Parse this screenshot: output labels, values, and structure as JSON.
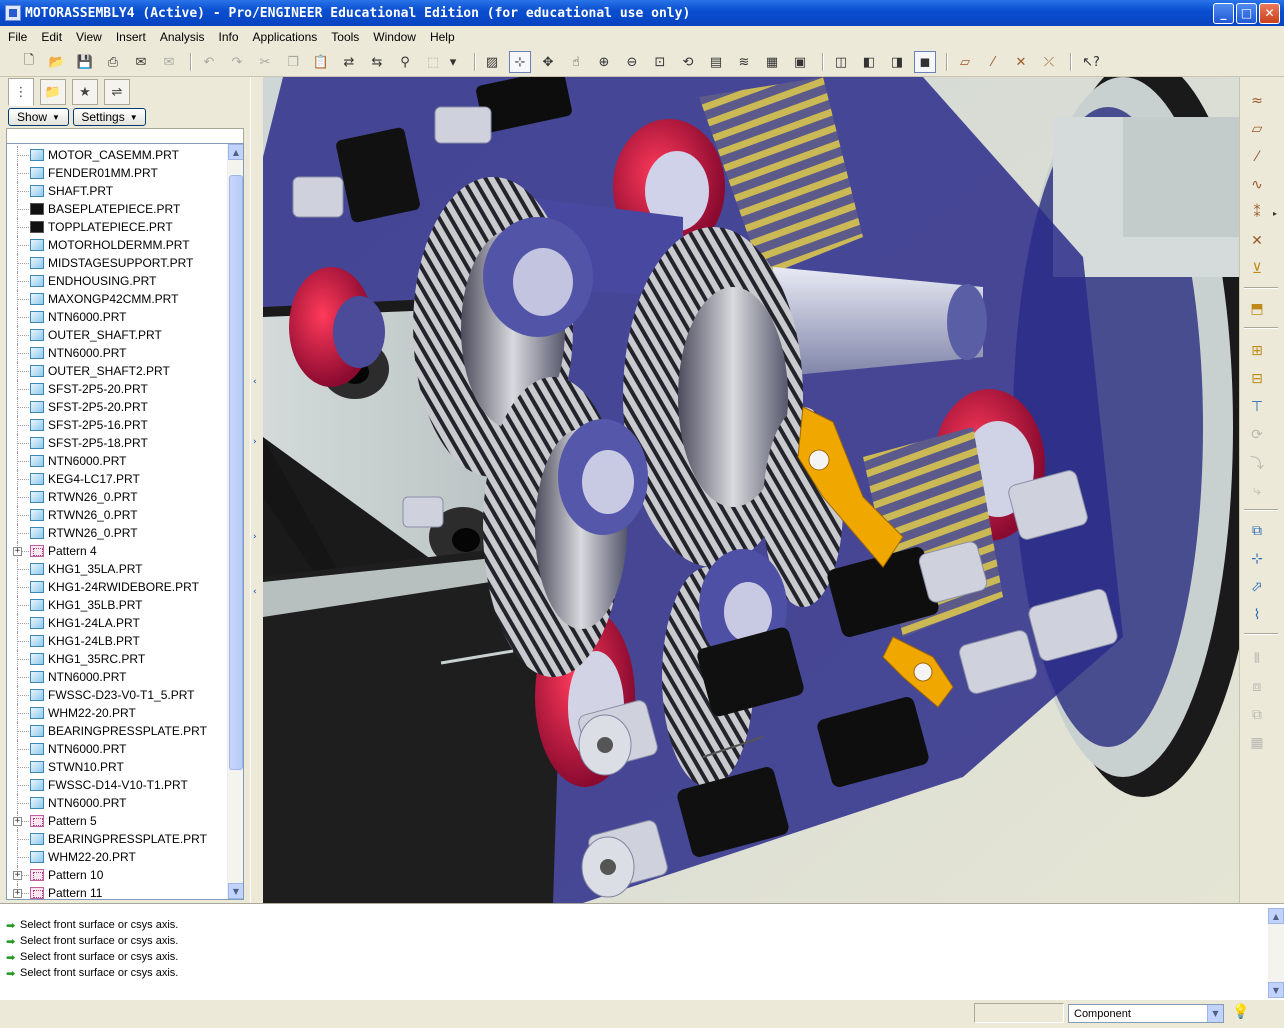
{
  "window": {
    "title": "MOTORASSEMBLY4 (Active) - Pro/ENGINEER Educational Edition (for educational use only)",
    "buttons": {
      "minimize": "_",
      "maximize": "□",
      "close": "✕"
    }
  },
  "menu": [
    "File",
    "Edit",
    "View",
    "Insert",
    "Analysis",
    "Info",
    "Applications",
    "Tools",
    "Window",
    "Help"
  ],
  "toolbar_icons": [
    "new-icon",
    "open-icon",
    "save-icon",
    "print-icon",
    "send-mail-icon",
    "send-mail-attach-icon",
    "undo-icon",
    "redo-icon",
    "cut-icon",
    "copy-icon",
    "paste-icon",
    "paste-special-icon",
    "regenerate-icon",
    "regenerate-manager-icon",
    "find-icon",
    "select-box-icon",
    "select-dropdown-icon",
    "repaint-icon",
    "spin-center-icon",
    "orient-mode-icon",
    "pan-icon",
    "zoom-in-icon",
    "zoom-out-icon",
    "refit-icon",
    "reorient-icon",
    "saved-views-icon",
    "layers-icon",
    "view-manager-icon",
    "wireframe-icon",
    "hidden-line-icon",
    "no-hidden-icon",
    "shading-icon",
    "datum-planes-icon",
    "datum-axes-icon",
    "datum-points-icon",
    "coordinate-systems-icon",
    "context-help-icon"
  ],
  "panel": {
    "tabs": [
      "model-tree-tab",
      "folder-browser-tab",
      "favorites-tab",
      "connections-tab"
    ],
    "show_label": "Show",
    "settings_label": "Settings",
    "tree_items": [
      {
        "label": "MOTOR_CASEMM.PRT",
        "kind": "part"
      },
      {
        "label": "FENDER01MM.PRT",
        "kind": "part"
      },
      {
        "label": "SHAFT.PRT",
        "kind": "part"
      },
      {
        "label": "BASEPLATEPIECE.PRT",
        "kind": "part-dark"
      },
      {
        "label": "TOPPLATEPIECE.PRT",
        "kind": "part-dark"
      },
      {
        "label": "MOTORHOLDERMM.PRT",
        "kind": "part"
      },
      {
        "label": "MIDSTAGESUPPORT.PRT",
        "kind": "part"
      },
      {
        "label": "ENDHOUSING.PRT",
        "kind": "part"
      },
      {
        "label": "MAXONGP42CMM.PRT",
        "kind": "part"
      },
      {
        "label": "NTN6000.PRT",
        "kind": "part"
      },
      {
        "label": "OUTER_SHAFT.PRT",
        "kind": "part"
      },
      {
        "label": "NTN6000.PRT",
        "kind": "part"
      },
      {
        "label": "OUTER_SHAFT2.PRT",
        "kind": "part"
      },
      {
        "label": "SFST-2P5-20.PRT",
        "kind": "part"
      },
      {
        "label": "SFST-2P5-20.PRT",
        "kind": "part"
      },
      {
        "label": "SFST-2P5-16.PRT",
        "kind": "part"
      },
      {
        "label": "SFST-2P5-18.PRT",
        "kind": "part"
      },
      {
        "label": "NTN6000.PRT",
        "kind": "part"
      },
      {
        "label": "KEG4-LC17.PRT",
        "kind": "part"
      },
      {
        "label": "RTWN26_0.PRT",
        "kind": "part"
      },
      {
        "label": "RTWN26_0.PRT",
        "kind": "part"
      },
      {
        "label": "RTWN26_0.PRT",
        "kind": "part"
      },
      {
        "label": "Pattern 4",
        "kind": "pattern"
      },
      {
        "label": "KHG1_35LA.PRT",
        "kind": "part"
      },
      {
        "label": "KHG1-24RWIDEBORE.PRT",
        "kind": "part"
      },
      {
        "label": "KHG1_35LB.PRT",
        "kind": "part"
      },
      {
        "label": "KHG1-24LA.PRT",
        "kind": "part"
      },
      {
        "label": "KHG1-24LB.PRT",
        "kind": "part"
      },
      {
        "label": "KHG1_35RC.PRT",
        "kind": "part"
      },
      {
        "label": "NTN6000.PRT",
        "kind": "part"
      },
      {
        "label": "FWSSC-D23-V0-T1_5.PRT",
        "kind": "part"
      },
      {
        "label": "WHM22-20.PRT",
        "kind": "part"
      },
      {
        "label": "BEARINGPRESSPLATE.PRT",
        "kind": "part"
      },
      {
        "label": "NTN6000.PRT",
        "kind": "part"
      },
      {
        "label": "STWN10.PRT",
        "kind": "part"
      },
      {
        "label": "FWSSC-D14-V10-T1.PRT",
        "kind": "part"
      },
      {
        "label": "NTN6000.PRT",
        "kind": "part"
      },
      {
        "label": "Pattern 5",
        "kind": "pattern"
      },
      {
        "label": "BEARINGPRESSPLATE.PRT",
        "kind": "part"
      },
      {
        "label": "WHM22-20.PRT",
        "kind": "part"
      },
      {
        "label": "Pattern 10",
        "kind": "pattern"
      },
      {
        "label": "Pattern 11",
        "kind": "pattern"
      }
    ]
  },
  "right_toolbar_icons": [
    "sketched-curve-icon",
    "datum-plane-icon",
    "datum-axis-icon",
    "datum-curve-icon",
    "datum-point-icon",
    "datum-point-dropdown-icon",
    "offset-point-icon",
    "coordinate-system-icon",
    "analysis-feature-icon",
    "insert-component-icon",
    "create-component-icon",
    "extrude-icon",
    "revolve-icon",
    "sweep-icon",
    "blend-icon",
    "hole-icon",
    "round-icon",
    "chamfer-icon",
    "draft-icon",
    "mirror-icon",
    "move-icon",
    "copy-feature-icon",
    "pattern-icon"
  ],
  "messages": [
    "Select front surface or csys axis.",
    "Select front surface or csys axis.",
    "Select front surface or csys axis.",
    "Select front surface or csys axis."
  ],
  "status": {
    "filter_value": "Component"
  },
  "colors": {
    "titlebar": "#0a4fd0",
    "chrome": "#ece9d8",
    "bearing_red": "#c0103c",
    "housing_blue": "#3c3caa",
    "bracket_orange": "#f0a800",
    "spring_yellow": "#c8b44a"
  }
}
